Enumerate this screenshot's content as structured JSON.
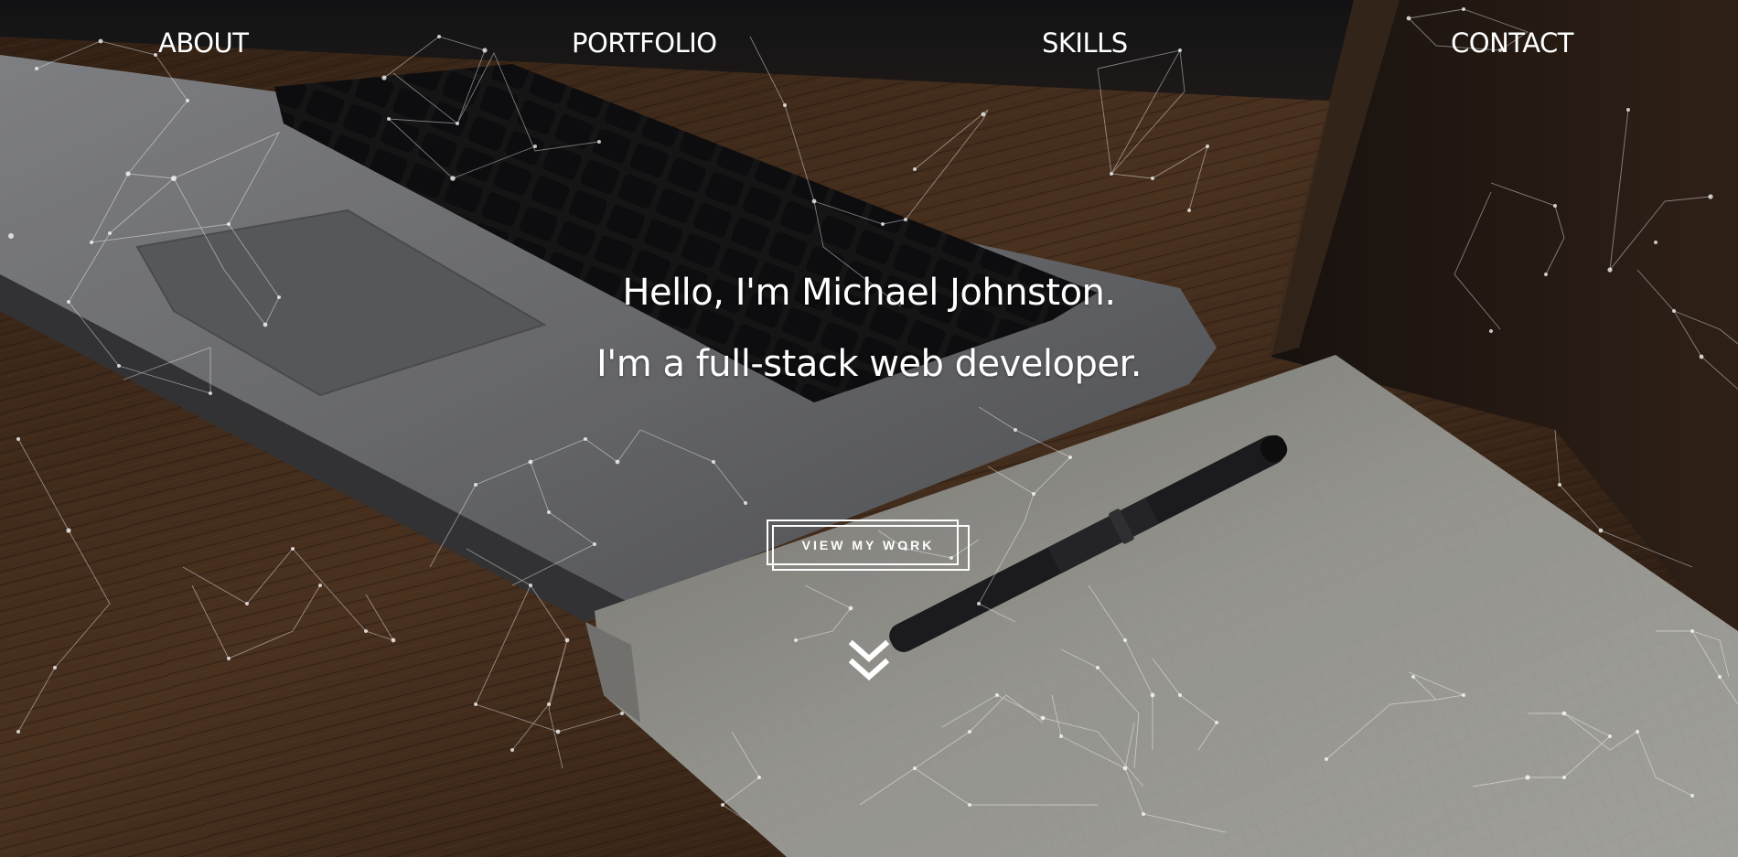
{
  "nav": {
    "items": [
      {
        "label": "ABOUT"
      },
      {
        "label": "PORTFOLIO"
      },
      {
        "label": "SKILLS"
      },
      {
        "label": "CONTACT"
      }
    ]
  },
  "hero": {
    "greeting": "Hello, I'm Michael Johnston.",
    "tagline": "I'm a full-stack web developer.",
    "cta_label": "VIEW MY WORK",
    "scroll_icon": "double-chevron-down-icon"
  },
  "colors": {
    "text": "#ffffff",
    "network_line": "#ffffff",
    "desk_wood": "#4a3222",
    "laptop": "#7f8084",
    "notebook": "#b7b6ae"
  }
}
